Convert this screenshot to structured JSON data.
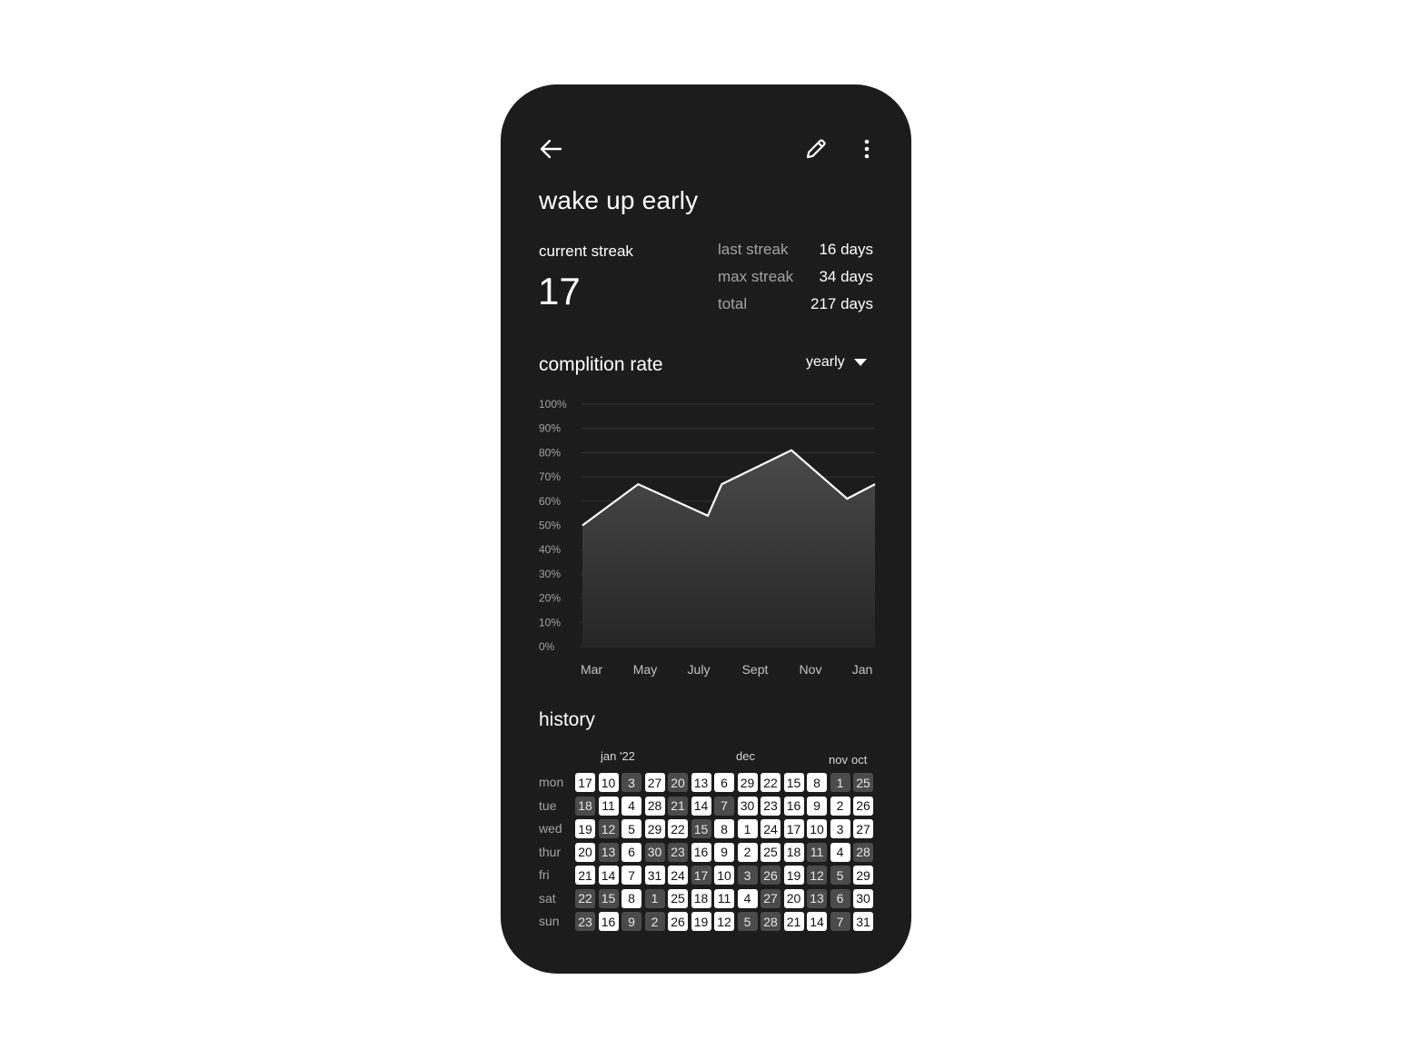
{
  "habit": {
    "title": "wake up early",
    "current_streak_label": "current streak",
    "current_streak_value": "17"
  },
  "stats": [
    {
      "label": "last streak",
      "value": "16 days"
    },
    {
      "label": "max streak",
      "value": "34 days"
    },
    {
      "label": "total",
      "value": "217 days"
    }
  ],
  "icons": {
    "back": "arrow-left-icon",
    "edit": "pencil-icon",
    "more": "vertical-dots-icon",
    "dropdown": "caret-down-icon"
  },
  "completion": {
    "title": "complition rate",
    "period": "yearly"
  },
  "chart_data": {
    "type": "area",
    "y_ticks": [
      "0%",
      "10%",
      "20%",
      "30%",
      "40%",
      "50%",
      "60%",
      "70%",
      "80%",
      "90%",
      "100%"
    ],
    "x_tick_labels": [
      "Mar",
      "May",
      "July",
      "Sept",
      "Nov",
      "Jan"
    ],
    "x_tick_positions": [
      0,
      2,
      4,
      6,
      8,
      10
    ],
    "ylim": [
      0,
      100
    ],
    "xlim": [
      0,
      10.5
    ],
    "grid": true,
    "series": [
      {
        "x": [
          0,
          2,
          4.5,
          5,
          7.5,
          9.5,
          11
        ],
        "values": [
          50,
          67,
          54,
          67,
          81,
          61,
          67
        ]
      }
    ]
  },
  "history": {
    "title": "history",
    "month_labels": [
      {
        "label": "jan '22",
        "col": 1
      },
      {
        "label": "dec",
        "col": 7
      },
      {
        "label": "nov",
        "col": 11
      },
      {
        "label": "oct",
        "col": 12
      }
    ],
    "days": [
      "mon",
      "tue",
      "wed",
      "thur",
      "fri",
      "sat",
      "sun"
    ],
    "columns": [
      [
        {
          "d": "17",
          "on": 1
        },
        {
          "d": "18",
          "on": 0
        },
        {
          "d": "19",
          "on": 1
        },
        {
          "d": "20",
          "on": 1
        },
        {
          "d": "21",
          "on": 1
        },
        {
          "d": "22",
          "on": 0
        },
        {
          "d": "23",
          "on": 0
        }
      ],
      [
        {
          "d": "10",
          "on": 1
        },
        {
          "d": "11",
          "on": 1
        },
        {
          "d": "12",
          "on": 0
        },
        {
          "d": "13",
          "on": 0
        },
        {
          "d": "14",
          "on": 1
        },
        {
          "d": "15",
          "on": 0
        },
        {
          "d": "16",
          "on": 1
        }
      ],
      [
        {
          "d": "3",
          "on": 0
        },
        {
          "d": "4",
          "on": 1
        },
        {
          "d": "5",
          "on": 1
        },
        {
          "d": "6",
          "on": 1
        },
        {
          "d": "7",
          "on": 1
        },
        {
          "d": "8",
          "on": 1
        },
        {
          "d": "9",
          "on": 0
        }
      ],
      [
        {
          "d": "27",
          "on": 1
        },
        {
          "d": "28",
          "on": 1
        },
        {
          "d": "29",
          "on": 1
        },
        {
          "d": "30",
          "on": 0
        },
        {
          "d": "31",
          "on": 1
        },
        {
          "d": "1",
          "on": 0
        },
        {
          "d": "2",
          "on": 0
        }
      ],
      [
        {
          "d": "20",
          "on": 0
        },
        {
          "d": "21",
          "on": 0
        },
        {
          "d": "22",
          "on": 1
        },
        {
          "d": "23",
          "on": 0
        },
        {
          "d": "24",
          "on": 1
        },
        {
          "d": "25",
          "on": 1
        },
        {
          "d": "26",
          "on": 1
        }
      ],
      [
        {
          "d": "13",
          "on": 1
        },
        {
          "d": "14",
          "on": 1
        },
        {
          "d": "15",
          "on": 0
        },
        {
          "d": "16",
          "on": 1
        },
        {
          "d": "17",
          "on": 0
        },
        {
          "d": "18",
          "on": 1
        },
        {
          "d": "19",
          "on": 1
        }
      ],
      [
        {
          "d": "6",
          "on": 1
        },
        {
          "d": "7",
          "on": 0
        },
        {
          "d": "8",
          "on": 1
        },
        {
          "d": "9",
          "on": 1
        },
        {
          "d": "10",
          "on": 1
        },
        {
          "d": "11",
          "on": 1
        },
        {
          "d": "12",
          "on": 1
        }
      ],
      [
        {
          "d": "29",
          "on": 1
        },
        {
          "d": "30",
          "on": 1
        },
        {
          "d": "1",
          "on": 1
        },
        {
          "d": "2",
          "on": 1
        },
        {
          "d": "3",
          "on": 0
        },
        {
          "d": "4",
          "on": 1
        },
        {
          "d": "5",
          "on": 0
        }
      ],
      [
        {
          "d": "22",
          "on": 1
        },
        {
          "d": "23",
          "on": 1
        },
        {
          "d": "24",
          "on": 1
        },
        {
          "d": "25",
          "on": 1
        },
        {
          "d": "26",
          "on": 0
        },
        {
          "d": "27",
          "on": 0
        },
        {
          "d": "28",
          "on": 0
        }
      ],
      [
        {
          "d": "15",
          "on": 1
        },
        {
          "d": "16",
          "on": 1
        },
        {
          "d": "17",
          "on": 1
        },
        {
          "d": "18",
          "on": 1
        },
        {
          "d": "19",
          "on": 1
        },
        {
          "d": "20",
          "on": 1
        },
        {
          "d": "21",
          "on": 1
        }
      ],
      [
        {
          "d": "8",
          "on": 1
        },
        {
          "d": "9",
          "on": 1
        },
        {
          "d": "10",
          "on": 1
        },
        {
          "d": "11",
          "on": 0
        },
        {
          "d": "12",
          "on": 0
        },
        {
          "d": "13",
          "on": 0
        },
        {
          "d": "14",
          "on": 1
        }
      ],
      [
        {
          "d": "1",
          "on": 0
        },
        {
          "d": "2",
          "on": 1
        },
        {
          "d": "3",
          "on": 1
        },
        {
          "d": "4",
          "on": 1
        },
        {
          "d": "5",
          "on": 0
        },
        {
          "d": "6",
          "on": 0
        },
        {
          "d": "7",
          "on": 0
        }
      ],
      [
        {
          "d": "25",
          "on": 0
        },
        {
          "d": "26",
          "on": 1
        },
        {
          "d": "27",
          "on": 1
        },
        {
          "d": "28",
          "on": 0
        },
        {
          "d": "29",
          "on": 1
        },
        {
          "d": "30",
          "on": 1
        },
        {
          "d": "31",
          "on": 1
        }
      ]
    ]
  }
}
